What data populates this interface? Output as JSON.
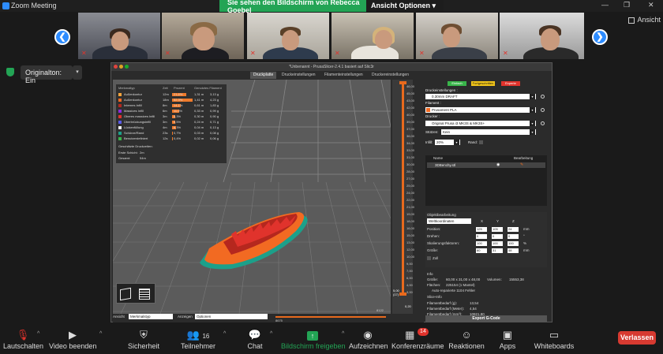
{
  "window": {
    "title": "Zoom Meeting",
    "controls": [
      "—",
      "❐",
      "✕"
    ]
  },
  "share": {
    "banner": "Sie sehen den Bildschirm von Rebecca Goebel",
    "view_options": "Ansicht Optionen ▾"
  },
  "view": {
    "label": "Ansicht"
  },
  "original_sound": {
    "label": "Originalton: Ein",
    "arrow": "▾"
  },
  "nav": {
    "prev": "❮",
    "next": "❯"
  },
  "slicer": {
    "title": "*Unbenannt - PrusaSlicer-2.4.1 basiert auf Slic3r",
    "tabs": [
      "Druckplatte",
      "Druckeinstellungen",
      "Filamenteinstellungen",
      "Druckereinstellungen"
    ],
    "legend": {
      "headers": [
        "Merkmaltyp",
        "Zeit",
        "Prozent",
        "Genutztes Filament"
      ],
      "rows": [
        {
          "name": "Außenkontur",
          "time": "12m",
          "pct": "21,6%",
          "m": "1,31 m",
          "g": "3,13 g",
          "color": "#f7a43b",
          "bar": 0.22
        },
        {
          "name": "Außenkontur",
          "time": "18m",
          "pct": "32,3%",
          "m": "1,41 m",
          "g": "4,23 g",
          "color": "#f26a22",
          "bar": 0.32
        },
        {
          "name": "Internes Infill",
          "time": "8m",
          "pct": "14,1%",
          "m": "0,61 m",
          "g": "1,83 g",
          "color": "#b5271e",
          "bar": 0.14
        },
        {
          "name": "Massives Infill",
          "time": "6m",
          "pct": "11,0%",
          "m": "0,33 m",
          "g": "0,99 g",
          "color": "#8c2ae0",
          "bar": 0.11
        },
        {
          "name": "Oberes massives Infill",
          "time": "3m",
          "pct": "5,3%",
          "m": "0,30 m",
          "g": "0,90 g",
          "color": "#e0332c",
          "bar": 0.05
        },
        {
          "name": "Überbrückungsinfill",
          "time": "3m",
          "pct": "5,5%",
          "m": "0,24 m",
          "g": "0,71 g",
          "color": "#5a5ae8",
          "bar": 0.05
        },
        {
          "name": "Lückenfüllung",
          "time": "4m",
          "pct": "6,3%",
          "m": "0,04 m",
          "g": "0,13 g",
          "color": "#f0f0f0",
          "bar": 0.06
        },
        {
          "name": "Schürze/Rand",
          "time": "23s",
          "pct": "0,7%",
          "m": "0,03 m",
          "g": "0,08 g",
          "color": "#1ca08a",
          "bar": 0.01
        },
        {
          "name": "Benutzerdefiniert",
          "time": "12s",
          "pct": "0,4%",
          "m": "0,02 m",
          "g": "0,06 g",
          "color": "#39b54a",
          "bar": 0.01
        }
      ],
      "estimated_label": "Geschätzte Druckzeiten:",
      "first_layer": "Erste Schicht:",
      "first_layer_val": "2m",
      "total": "Gesamt:",
      "total_val": "54m"
    },
    "vslider": {
      "ticks": [
        "46,00",
        "45,00",
        "43,00",
        "42,00",
        "40,00",
        "39,00",
        "37,00",
        "36,00",
        "34,00",
        "33,00",
        "31,00",
        "30,00",
        "28,00",
        "27,00",
        "25,00",
        "24,00",
        "22,00",
        "21,00",
        "19,00",
        "18,00",
        "16,00",
        "15,00",
        "13,00",
        "12,00",
        "10,00",
        "9,00",
        "7,00",
        "6,00",
        "4,00",
        "3,00"
      ],
      "top_val": "46,00\n(240)",
      "bottom_val": "0,20",
      "mid_val": "5,00\n(17)"
    },
    "hslider": {
      "left_val": "8675",
      "right_val": "8122"
    },
    "bottom_bar": {
      "view_label": "Ansicht",
      "view_value": "Merkmalstyp",
      "show_label": "Anzeigen",
      "show_value": "Optionen"
    },
    "right": {
      "mode_buttons": [
        "Einfach",
        "Fortgeschritten",
        "Experte"
      ],
      "print_settings_label": "Druckeinstellungen :",
      "print_settings": "0.30mm DRAFT",
      "filament_label": "Filament :",
      "filament": "Prusament PLA",
      "printer_label": "Drucker :",
      "printer": "Original Prusa i3 MK3S & MK3S+",
      "supports_label": "Stützen:",
      "supports": "Kein",
      "infill_label": "Infill:",
      "infill": "20%",
      "brim_label": "Rand:",
      "list_headers": [
        "Name",
        "Bearbeitung"
      ],
      "object": "3DBenchy.stl",
      "obj_edit_title": "Objektbearbeitung",
      "coords": "Weltkoordinaten",
      "axes": [
        "X",
        "Y",
        "Z"
      ],
      "position_label": "Position:",
      "position": [
        "125",
        "105",
        "24"
      ],
      "rotation_label": "Drehen:",
      "rotation": [
        "0",
        "0",
        "0"
      ],
      "scale_label": "Skalierungsfaktoren:",
      "scale": [
        "100",
        "100",
        "100"
      ],
      "size_label": "Größe:",
      "size": [
        "60",
        "31",
        "48"
      ],
      "units": [
        "mm",
        "°",
        "%",
        "mm"
      ],
      "inch_label": "Zoll",
      "info_title": "Info",
      "size_info_label": "Größe:",
      "size_info": "60,00 x 31,00 x 48,00",
      "volume_label": "Volumen:",
      "volume": "15553,38",
      "facets_label": "Flächen:",
      "facets": "225154 (1 Mantel)",
      "repaired": "Auto-reparierte 1104 Fehler",
      "slice_info_title": "Slice-Info",
      "filament_g_label": "Filamentbedarf (g):",
      "filament_g": "13,54",
      "filament_m_label": "Filamentbedarf (Meter):",
      "filament_m": "4,54",
      "filament_mm3_label": "Filamentbedarf (mm³):",
      "filament_mm3": "10921,80",
      "export": "Export G-Code"
    }
  },
  "toolbar": {
    "mute": "Lautschalten",
    "video": "Video beenden",
    "security": "Sicherheit",
    "participants": "Teilnehmer",
    "participants_count": "16",
    "chat": "Chat",
    "share": "Bildschirm freigeben",
    "record": "Aufzeichnen",
    "breakout": "Konferenzräume",
    "breakout_badge": "14",
    "reactions": "Reaktionen",
    "apps": "Apps",
    "whiteboards": "Whiteboards",
    "leave": "Verlassen"
  }
}
